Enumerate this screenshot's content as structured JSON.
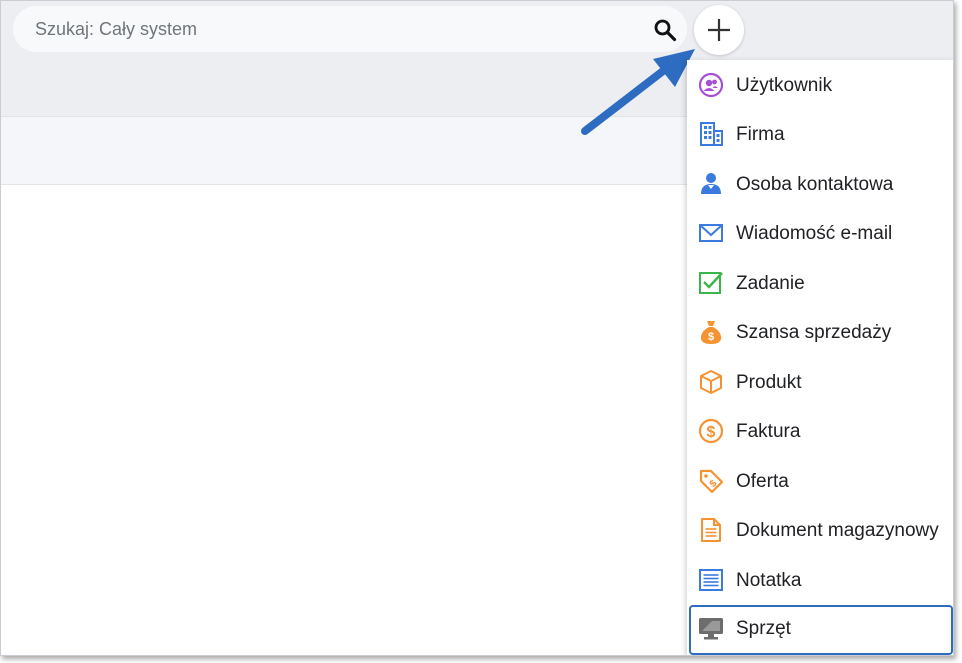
{
  "search": {
    "placeholder": "Szukaj: Cały system",
    "search_icon": "search-icon"
  },
  "add_button": {
    "icon": "plus-icon"
  },
  "annotation": {
    "icon": "arrow-annotation",
    "color": "#2d6cc0"
  },
  "menu": {
    "items": [
      {
        "label": "Użytkownik",
        "icon": "user-icon",
        "color": "#a64fd6"
      },
      {
        "label": "Firma",
        "icon": "building-icon",
        "color": "#3b7be0"
      },
      {
        "label": "Osoba kontaktowa",
        "icon": "contact-person-icon",
        "color": "#3b7be0"
      },
      {
        "label": "Wiadomość e-mail",
        "icon": "envelope-icon",
        "color": "#3b7be0"
      },
      {
        "label": "Zadanie",
        "icon": "checkbox-icon",
        "color": "#3cb54a"
      },
      {
        "label": "Szansa sprzedaży",
        "icon": "money-bag-icon",
        "color": "#f59231"
      },
      {
        "label": "Produkt",
        "icon": "box-icon",
        "color": "#f59231"
      },
      {
        "label": "Faktura",
        "icon": "dollar-circle-icon",
        "color": "#f59231"
      },
      {
        "label": "Oferta",
        "icon": "price-tag-icon",
        "color": "#f59231"
      },
      {
        "label": "Dokument magazynowy",
        "icon": "document-icon",
        "color": "#f59231"
      },
      {
        "label": "Notatka",
        "icon": "note-icon",
        "color": "#3b7be0"
      },
      {
        "label": "Sprzęt",
        "icon": "monitor-icon",
        "color": "#6d6d6d",
        "selected": true
      }
    ],
    "selected_border_color": "#2d6cc0"
  }
}
